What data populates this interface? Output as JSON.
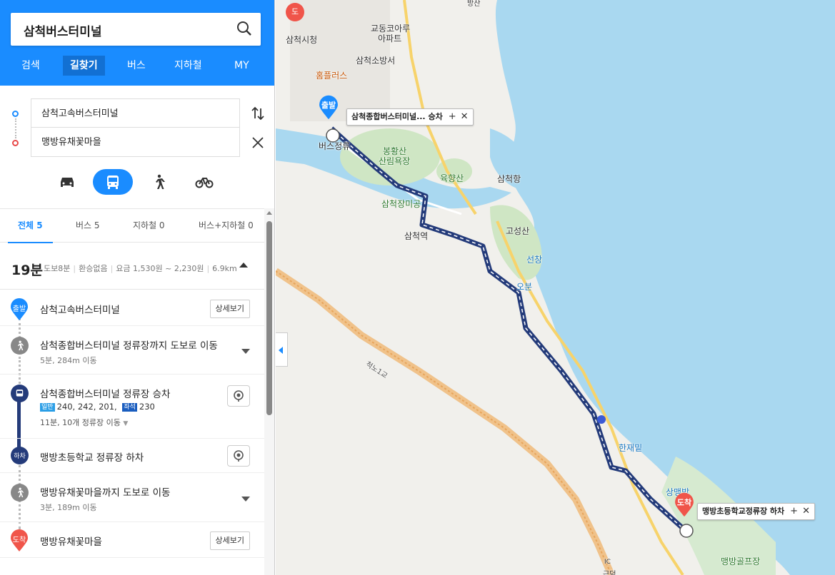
{
  "search": {
    "query": "삼척버스터미널"
  },
  "nav": {
    "tabs": [
      "검색",
      "길찾기",
      "버스",
      "지하철",
      "MY"
    ],
    "active": "길찾기"
  },
  "route": {
    "origin": "삼척고속버스터미널",
    "destination": "맹방유채꽃마을"
  },
  "filters": {
    "all": "전체 5",
    "bus": "버스 5",
    "subway": "지하철 0",
    "bus_subway": "버스+지하철 0"
  },
  "summary": {
    "duration": "19분",
    "walk": "도보8분",
    "transfer": "환승없음",
    "fare": "요금 1,530원 ~ 2,230원",
    "distance": "6.9km"
  },
  "steps": {
    "start": {
      "marker": "출발",
      "name": "삼척고속버스터미널",
      "button": "상세보기"
    },
    "walk1": {
      "name": "삼척종합버스터미널 정류장까지 도보로 이동",
      "sub": "5분, 284m 이동"
    },
    "board": {
      "name": "삼척종합버스터미널 정류장 승차",
      "tag_general": "일반",
      "routes_general": "240,  242,  201,",
      "tag_seat": "좌석",
      "routes_seat": "230",
      "sub": "11분, 10개 정류장 이동"
    },
    "alight": {
      "marker": "하차",
      "name": "맹방초등학교 정류장 하차"
    },
    "walk2": {
      "name": "맹방유채꽃마을까지 도보로 이동",
      "sub": "3분, 189m 이동"
    },
    "end": {
      "marker": "도착",
      "name": "맹방유채꽃마을",
      "button": "상세보기"
    }
  },
  "map": {
    "labels": {
      "city_hall": "삼척시청",
      "apt": "교동코아루",
      "apt2": "아파트",
      "fire": "삼척소방서",
      "homeplus": "홈플러스",
      "terminal": "버스정류",
      "forest": "봉황산",
      "forest2": "산림욕장",
      "yukhyang": "육향산",
      "port": "삼척항",
      "park": "삼척장미공",
      "station": "삼척역",
      "goseong": "고성산",
      "seonchang": "선창",
      "obun": "오분",
      "bridge": "척노1교",
      "hanjae": "한재밑",
      "sangmaeng": "상맹방",
      "golf": "맹방골프장",
      "ic": "IC",
      "gundeok": "근덕",
      "do": "도",
      "museum": "방산"
    },
    "start_pin": "출발",
    "end_pin": "도착",
    "bubble_start": "삼척종합버스터미널...   승차",
    "bubble_end": "맹방초등학교정류장 하차"
  },
  "colors": {
    "accent": "#1a8cff",
    "route": "#243b7a",
    "sea": "#a9d8f0",
    "end_pin": "#f0554a"
  }
}
